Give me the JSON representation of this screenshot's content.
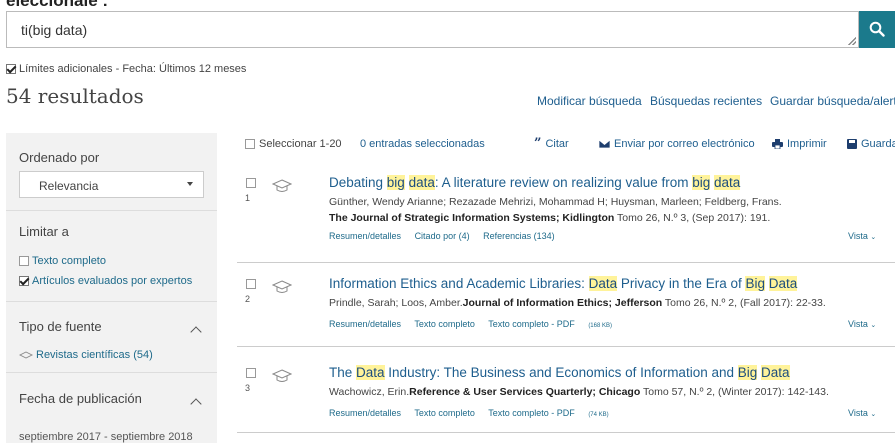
{
  "header_cut": "eleccionale :",
  "search": {
    "value": "ti(big data)"
  },
  "limits": {
    "text": "Límites adicionales - Fecha: Últimos 12 meses"
  },
  "results_count": "54 resultados",
  "top_links": {
    "modify": "Modificar búsqueda",
    "recent": "Búsquedas recientes",
    "save": "Guardar búsqueda/alerta"
  },
  "sidebar": {
    "sort_label": "Ordenado por",
    "sort_value": "Relevancia",
    "limit_label": "Limitar a",
    "limit_options": [
      {
        "label": "Texto completo",
        "checked": false
      },
      {
        "label": "Artículos evaluados por expertos",
        "checked": true
      }
    ],
    "source_label": "Tipo de fuente",
    "source_option": "Revistas científicas (54)",
    "date_label": "Fecha de publicación",
    "date_range": "septiembre 2017 - septiembre 2018"
  },
  "toolbar": {
    "select_range": "Seleccionar 1-20",
    "selected_count": "0 entradas seleccionadas",
    "cite": "Citar",
    "email": "Enviar por correo electrónico",
    "print": "Imprimir",
    "save": "Guarda"
  },
  "results": [
    {
      "number": "1",
      "title_parts": [
        {
          "text": "Debating ",
          "hl": false
        },
        {
          "text": "big",
          "hl": true
        },
        {
          "text": " ",
          "hl": false
        },
        {
          "text": "data",
          "hl": true
        },
        {
          "text": ": A literature review on realizing value from ",
          "hl": false
        },
        {
          "text": "big",
          "hl": true
        },
        {
          "text": " ",
          "hl": false
        },
        {
          "text": "data",
          "hl": true
        }
      ],
      "authors": "Günther, Wendy Arianne; Rezazade Mehrizi, Mohammad H; Huysman, Marleen; Feldberg, Frans.",
      "journal": "The Journal of Strategic Information Systems; Kidlington",
      "details": " Tomo 26, N.º 3,  (Sep 2017): 191.",
      "links": [
        "Resumen/detalles",
        "Citado por (4)",
        "Referencias (134)"
      ],
      "vista": "Vista"
    },
    {
      "number": "2",
      "title_parts": [
        {
          "text": "Information Ethics and Academic Libraries: ",
          "hl": false
        },
        {
          "text": "Data",
          "hl": true
        },
        {
          "text": " Privacy in the Era of ",
          "hl": false
        },
        {
          "text": "Big",
          "hl": true
        },
        {
          "text": " ",
          "hl": false
        },
        {
          "text": "Data",
          "hl": true
        }
      ],
      "authors": "Prindle, Sarah; Loos, Amber.",
      "journal": "Journal of Information Ethics; Jefferson",
      "details": " Tomo 26, N.º 2,  (Fall 2017): 22-33.",
      "links": [
        "Resumen/detalles",
        "Texto completo",
        "Texto completo - PDF"
      ],
      "pdf_size": "(168 KB)",
      "vista": "Vista"
    },
    {
      "number": "3",
      "title_parts": [
        {
          "text": "The ",
          "hl": false
        },
        {
          "text": "Data",
          "hl": true
        },
        {
          "text": " Industry: The Business and Economics of Information and ",
          "hl": false
        },
        {
          "text": "Big",
          "hl": true
        },
        {
          "text": " ",
          "hl": false
        },
        {
          "text": "Data",
          "hl": true
        }
      ],
      "authors": "Wachowicz, Erin.",
      "journal": "Reference & User Services Quarterly; Chicago",
      "details": " Tomo 57, N.º 2,  (Winter 2017): 142-143.",
      "links": [
        "Resumen/detalles",
        "Texto completo",
        "Texto completo - PDF"
      ],
      "pdf_size": "(74 KB)",
      "vista": "Vista"
    }
  ]
}
